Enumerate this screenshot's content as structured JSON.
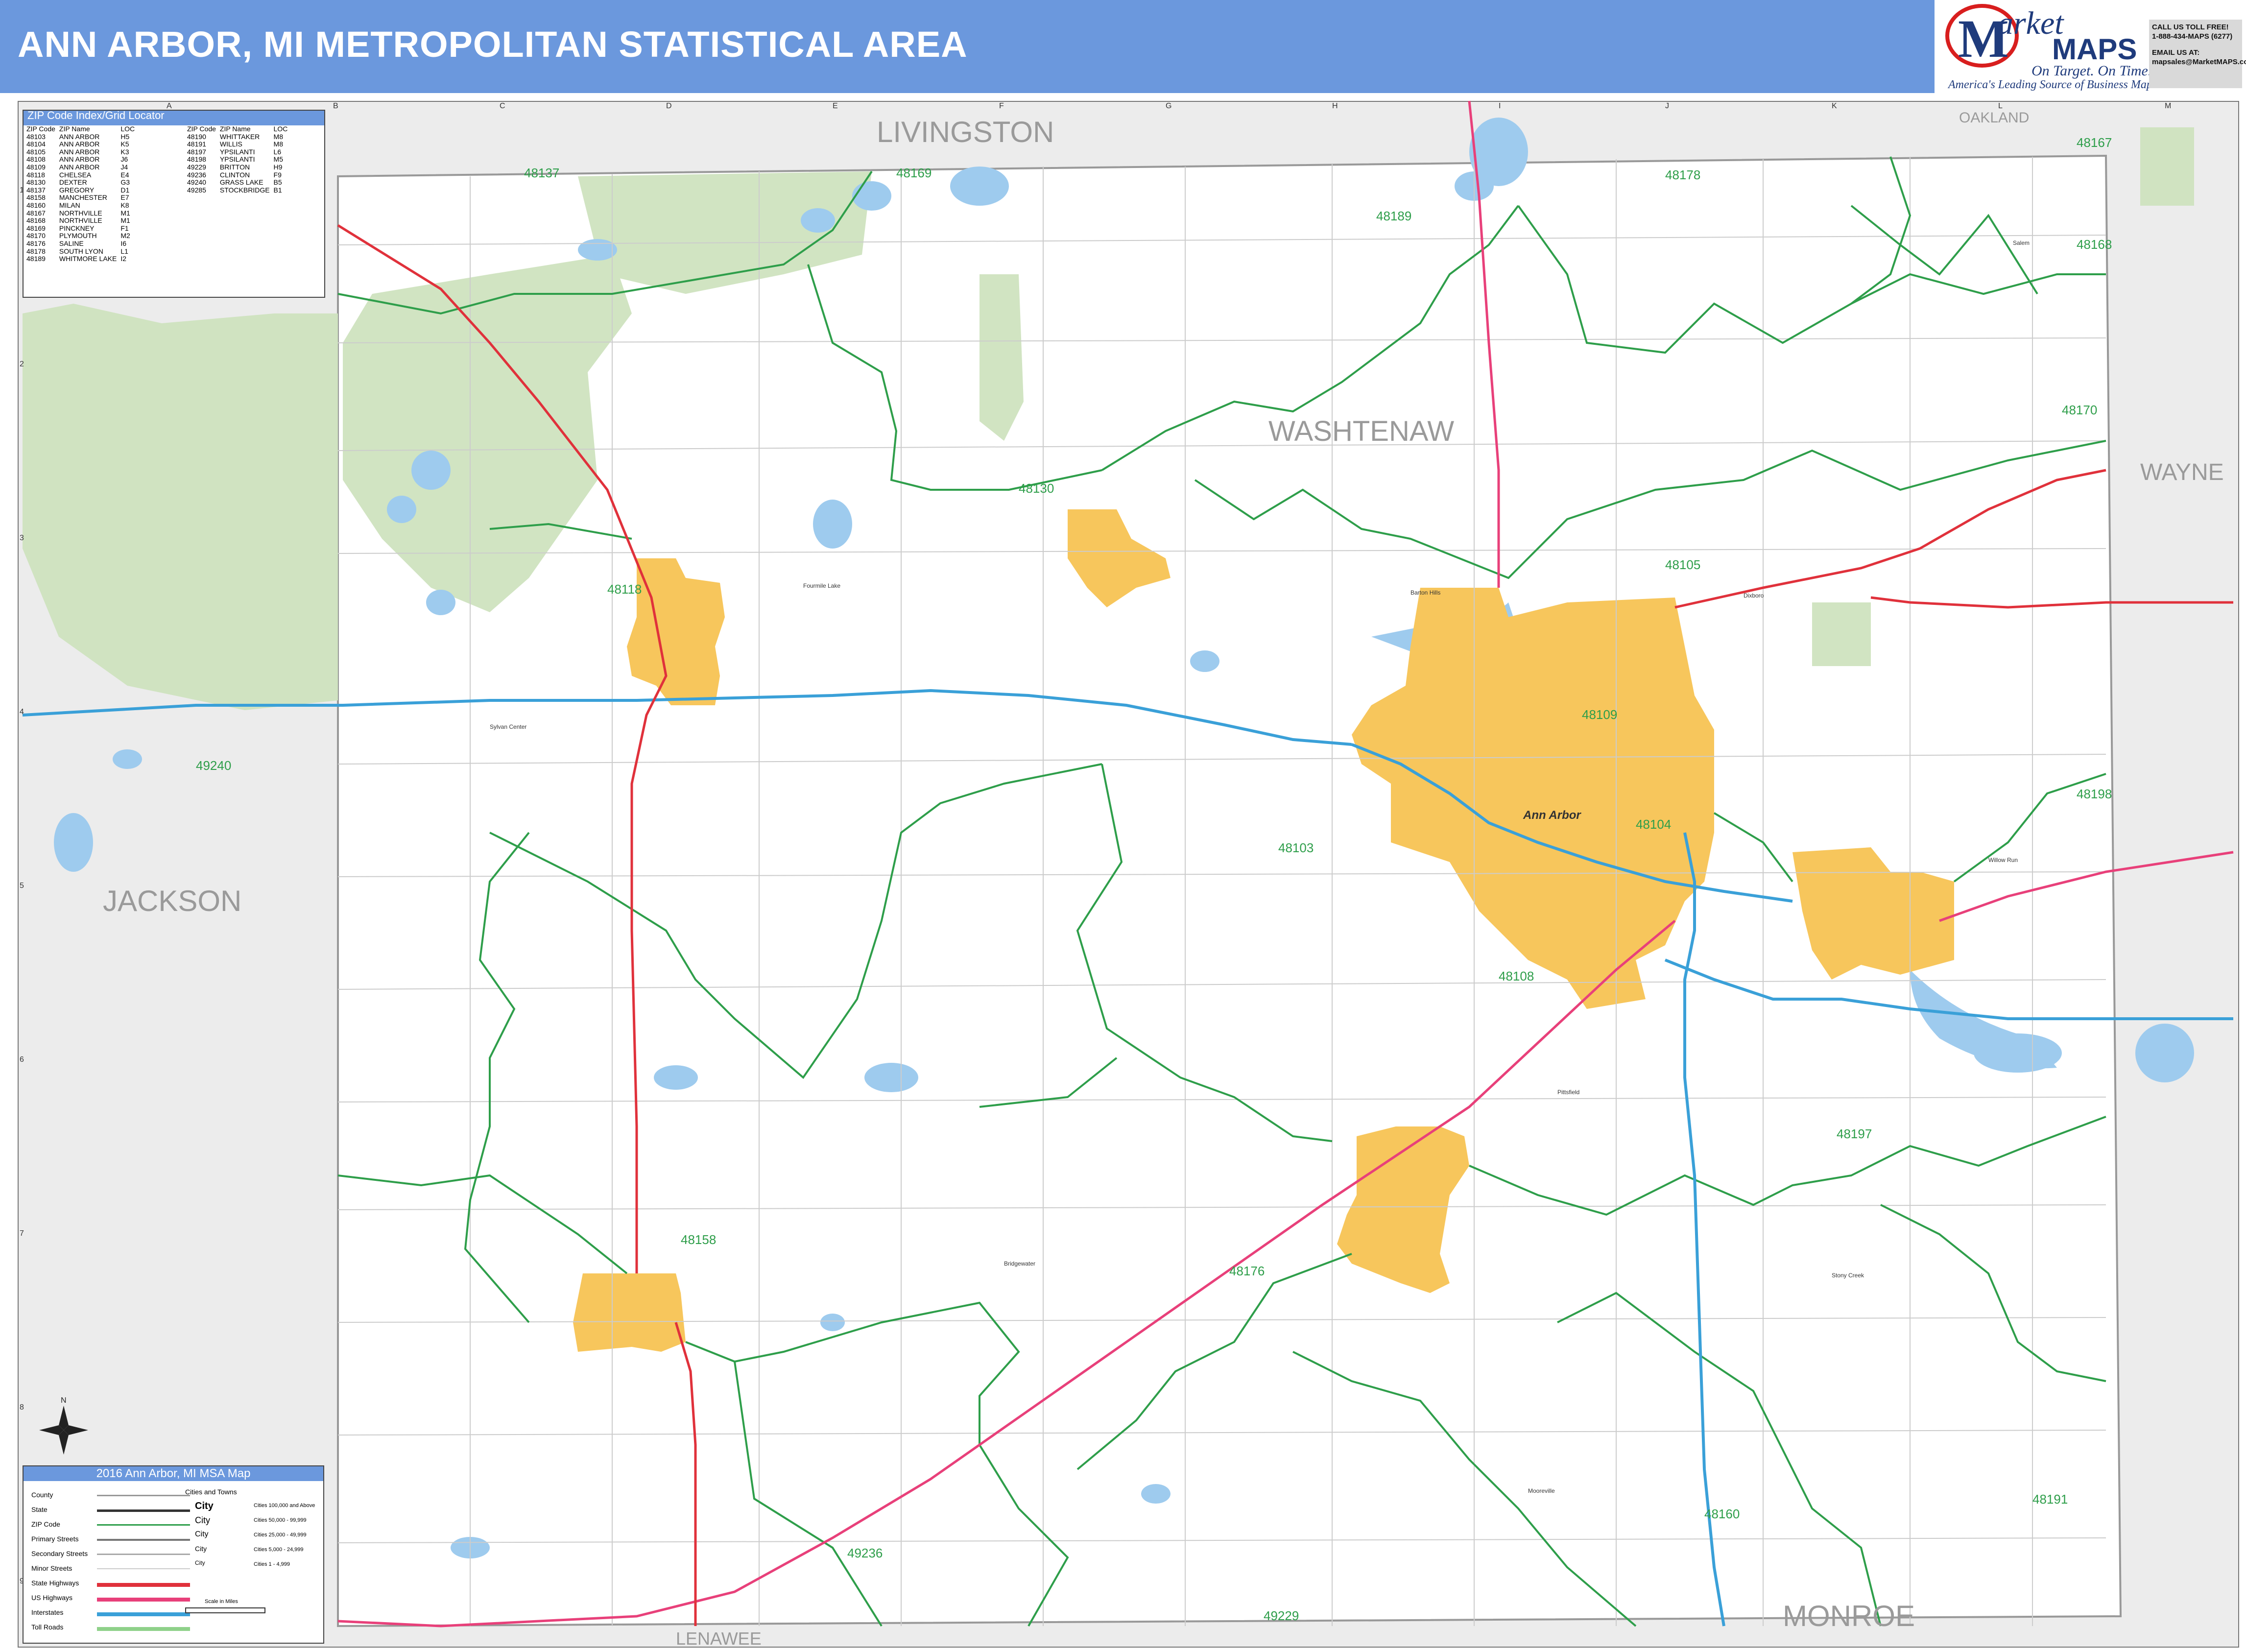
{
  "title": "ANN ARBOR, MI METROPOLITAN STATISTICAL AREA",
  "brand": {
    "logo_letter": "M",
    "market": "arket",
    "maps": "MAPS",
    "tagline": "On Target. On Time.",
    "subtagline": "America's Leading Source of Business Maps"
  },
  "contact": {
    "line1": "CALL US TOLL FREE!",
    "line2": "1-888-434-MAPS (6277)",
    "line3": "EMAIL US AT:",
    "line4": "mapsales@MarketMAPS.com"
  },
  "index_panel": {
    "header": "ZIP Code Index/Grid Locator",
    "col_zip": "ZIP Code",
    "col_name": "ZIP Name",
    "col_loc": "LOC",
    "left_rows": [
      [
        "48103",
        "ANN ARBOR",
        "H5"
      ],
      [
        "48104",
        "ANN ARBOR",
        "K5"
      ],
      [
        "48105",
        "ANN ARBOR",
        "K3"
      ],
      [
        "48108",
        "ANN ARBOR",
        "J6"
      ],
      [
        "48109",
        "ANN ARBOR",
        "J4"
      ],
      [
        "48118",
        "CHELSEA",
        "E4"
      ],
      [
        "48130",
        "DEXTER",
        "G3"
      ],
      [
        "48137",
        "GREGORY",
        "D1"
      ],
      [
        "48158",
        "MANCHESTER",
        "E7"
      ],
      [
        "48160",
        "MILAN",
        "K8"
      ],
      [
        "48167",
        "NORTHVILLE",
        "M1"
      ],
      [
        "48168",
        "NORTHVILLE",
        "M1"
      ],
      [
        "48169",
        "PINCKNEY",
        "F1"
      ],
      [
        "48170",
        "PLYMOUTH",
        "M2"
      ],
      [
        "48176",
        "SALINE",
        "I6"
      ],
      [
        "48178",
        "SOUTH LYON",
        "L1"
      ],
      [
        "48189",
        "WHITMORE LAKE",
        "I2"
      ]
    ],
    "right_rows": [
      [
        "48190",
        "WHITTAKER",
        "M8"
      ],
      [
        "48191",
        "WILLIS",
        "M8"
      ],
      [
        "48197",
        "YPSILANTI",
        "L6"
      ],
      [
        "48198",
        "YPSILANTI",
        "M5"
      ],
      [
        "49229",
        "BRITTON",
        "H9"
      ],
      [
        "49236",
        "CLINTON",
        "F9"
      ],
      [
        "49240",
        "GRASS LAKE",
        "B5"
      ],
      [
        "49285",
        "STOCKBRIDGE",
        "B1"
      ]
    ]
  },
  "legend": {
    "header": "2016 Ann Arbor, MI MSA Map",
    "items": [
      "County",
      "State",
      "ZIP Code",
      "Primary Streets",
      "Secondary Streets",
      "Minor Streets",
      "State Highways",
      "US Highways",
      "Interstates",
      "Toll Roads"
    ],
    "cities_header": "Cities and Towns",
    "city_sizes": [
      [
        "City",
        "Cities 100,000 and Above"
      ],
      [
        "City",
        "Cities 50,000 - 99,999"
      ],
      [
        "City",
        "Cities 25,000 - 49,999"
      ],
      [
        "City",
        "Cities 5,000 - 24,999"
      ],
      [
        "City",
        "Cities 1 - 4,999"
      ]
    ],
    "scale_label": "Scale in Miles"
  },
  "counties": {
    "livingston": "LIVINGSTON",
    "oakland": "OAKLAND",
    "washtenaw": "WASHTENAW",
    "wayne": "WAYNE",
    "jackson": "JACKSON",
    "lenawee": "LENAWEE",
    "monroe": "MONROE"
  },
  "zip_labels": {
    "z48137": "48137",
    "z48169": "48169",
    "z48189": "48189",
    "z48178": "48178",
    "z48167": "48167",
    "z48168": "48168",
    "z48170": "48170",
    "z48130": "48130",
    "z48118": "48118",
    "z48105": "48105",
    "z48109": "48109",
    "z48104": "48104",
    "z49240": "49240",
    "z48103": "48103",
    "z48198": "48198",
    "z48108": "48108",
    "z48197": "48197",
    "z48158": "48158",
    "z48176": "48176",
    "z49236": "49236",
    "z49229": "49229",
    "z48160": "48160",
    "z48191": "48191"
  },
  "places": {
    "ann_arbor": "Ann Arbor",
    "fourmile": "Fourmile Lake",
    "sylvan": "Sylvan Center",
    "bridgewater": "Bridgewater",
    "stony_creek": "Stony Creek",
    "pittsfield": "Pittsfield",
    "mooreville": "Mooreville",
    "willow_run": "Willow Run",
    "barton_hills": "Barton Hills",
    "salem": "Salem",
    "dixboro": "Dixboro"
  },
  "grid": {
    "cols": [
      "A",
      "B",
      "C",
      "D",
      "E",
      "F",
      "G",
      "H",
      "I",
      "J",
      "K",
      "L",
      "M"
    ],
    "rows": [
      "1",
      "2",
      "3",
      "4",
      "5",
      "6",
      "7",
      "8",
      "9"
    ]
  },
  "colors": {
    "title_bar": "#6b98dd",
    "city_fill": "#f7c65c",
    "zip_boundary": "#2e9e4a",
    "county_boundary": "#999999",
    "water": "#9ecbee",
    "park": "#cfe3bf",
    "interstate": "#3aa0d8",
    "us_highway": "#e8407a",
    "state_highway": "#e0313b"
  }
}
